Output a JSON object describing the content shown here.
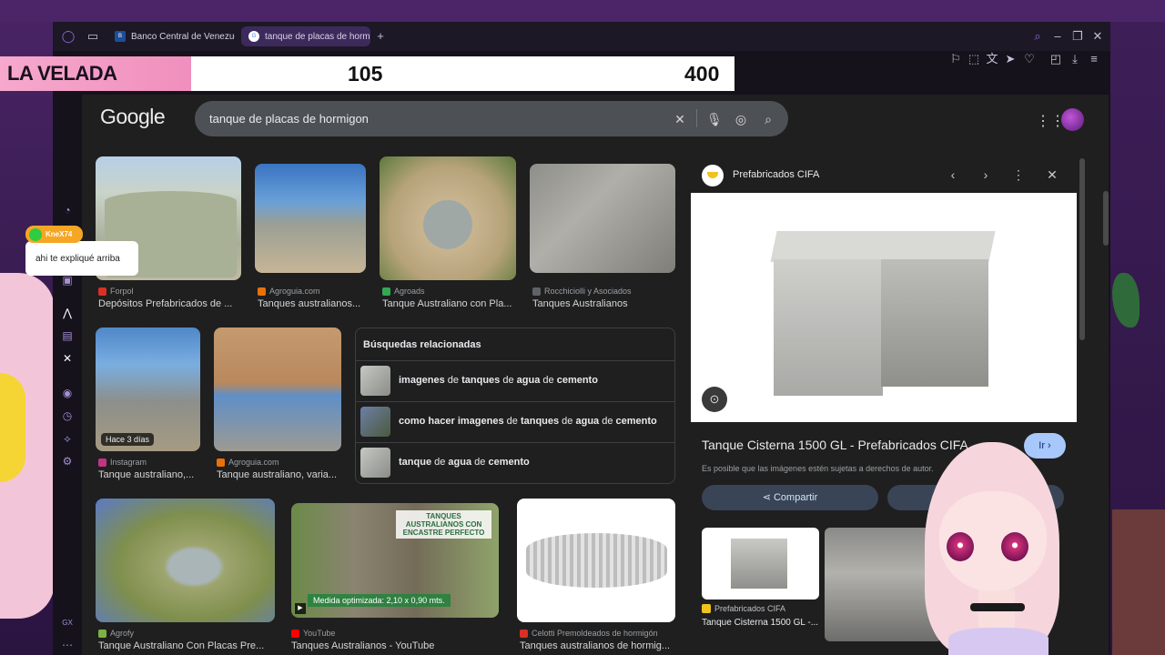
{
  "browser": {
    "tabs": [
      {
        "label": "Banco Central de Venezue",
        "favicon": "bcv-icon",
        "active": false
      },
      {
        "label": "tanque de placas de hormi",
        "favicon": "google-icon",
        "active": true
      }
    ],
    "new_tab": "+"
  },
  "overlay": {
    "title": "LA VELADA",
    "value_a": "105",
    "value_b": "400"
  },
  "chat": {
    "username": "KneX74",
    "message": "ahi te expliqué arriba"
  },
  "google": {
    "logo": "Google",
    "query": "tanque de placas de hormigon"
  },
  "results": [
    {
      "source": "Forpol",
      "title": "Depósitos Prefabricados de ...",
      "fav_color": "#d93025"
    },
    {
      "source": "Agroguia.com",
      "title": "Tanques australianos...",
      "fav_color": "#e8710a"
    },
    {
      "source": "Agroads",
      "title": "Tanque Australiano con Pla...",
      "fav_color": "#34a853"
    },
    {
      "source": "Rocchiciolli y Asociados",
      "title": "Tanques Australianos",
      "fav_color": "#5f6368"
    },
    {
      "source": "Instagram",
      "title": "Tanque australiano,...",
      "badge": "Hace 3 días",
      "fav_color": "#c13584"
    },
    {
      "source": "Agroguia.com",
      "title": "Tanque australiano, varia...",
      "fav_color": "#e8710a"
    },
    {
      "source": "Agrofy",
      "title": "Tanque Australiano Con Placas Pre...",
      "fav_color": "#7cb342"
    },
    {
      "source": "YouTube",
      "title": "Tanques Australianos - YouTube",
      "overlay_top": "TANQUES AUSTRALIANOS CON ENCASTRE PERFECTO",
      "overlay_bottom": "Medida optimizada: 2,10 x 0,90 mts.",
      "fav_color": "#ff0000"
    },
    {
      "source": "Celotti Premoldeados de hormigón",
      "title": "Tanques australianos de hormig...",
      "fav_color": "#d93025"
    }
  ],
  "related": {
    "heading": "Búsquedas relacionadas",
    "items": [
      "imagenes de tanques de agua de cemento",
      "como hacer imagenes de tanques de agua de cemento",
      "tanque de agua de cemento"
    ]
  },
  "panel": {
    "source": "Prefabricados CIFA",
    "title": "Tanque Cisterna 1500 GL - Prefabricados CIFA",
    "go_button": "Ir ›",
    "note": "Es posible que las imágenes estén sujetas a derechos de autor.",
    "share_button": "Compartir",
    "related_source": "Prefabricados CIFA",
    "related_title": "Tanque Cisterna 1500 GL -..."
  }
}
